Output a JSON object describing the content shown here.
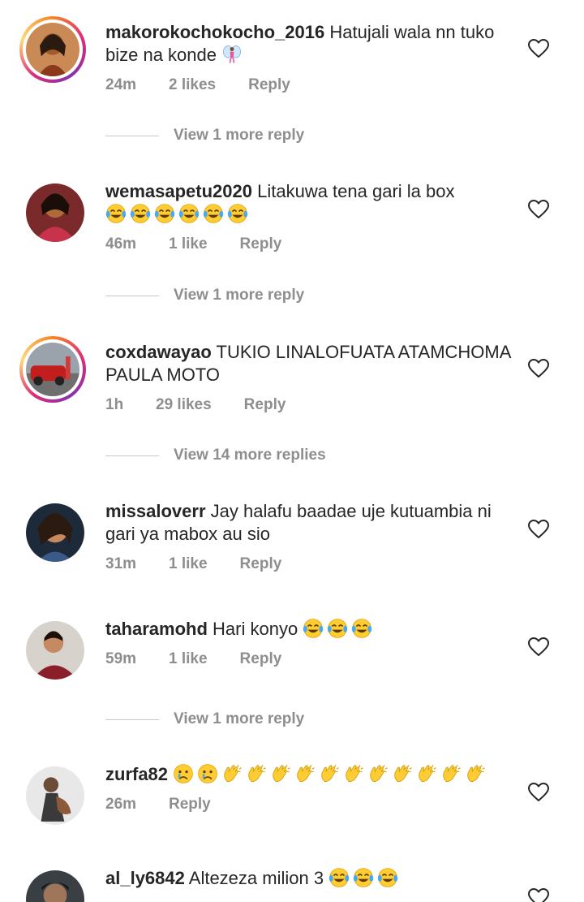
{
  "comments": [
    {
      "username": "makorokochokocho_2016",
      "text": " Hatujali wala nn tuko bize na konde ",
      "time": "24m",
      "likes": "2 likes",
      "reply": "Reply",
      "view_more": "View 1 more reply",
      "has_story": true
    },
    {
      "username": "wemasapetu2020",
      "text": " Litakuwa tena gari la box",
      "time": "46m",
      "likes": "1 like",
      "reply": "Reply",
      "view_more": "View 1 more reply",
      "has_story": false
    },
    {
      "username": "coxdawayao",
      "text": " TUKIO LINALOFUATA ATAMCHOMA PAULA MOTO",
      "time": "1h",
      "likes": "29 likes",
      "reply": "Reply",
      "view_more": "View 14 more replies",
      "has_story": true
    },
    {
      "username": "missaloverr",
      "text": " Jay halafu baadae uje kutuambia ni gari ya mabox au sio",
      "time": "31m",
      "likes": "1 like",
      "reply": "Reply",
      "has_story": false
    },
    {
      "username": "taharamohd",
      "text": " Hari konyo ",
      "time": "59m",
      "likes": "1 like",
      "reply": "Reply",
      "view_more": "View 1 more reply",
      "has_story": false
    },
    {
      "username": "zurfa82",
      "text": " ",
      "time": "26m",
      "reply": "Reply",
      "has_story": false
    },
    {
      "username": "al_ly6842",
      "text": " Altezeza milion 3 ",
      "has_story": false
    }
  ],
  "icons": {
    "like": "heart-outline-icon",
    "laugh": "face-with-tears-of-joy-emoji",
    "cry": "crying-face-emoji",
    "clap": "clapping-hands-emoji",
    "fairy": "fairy-emoji"
  },
  "colors": {
    "text": "#262626",
    "secondary": "#8e8e8e",
    "divider": "#c7c7c7"
  }
}
